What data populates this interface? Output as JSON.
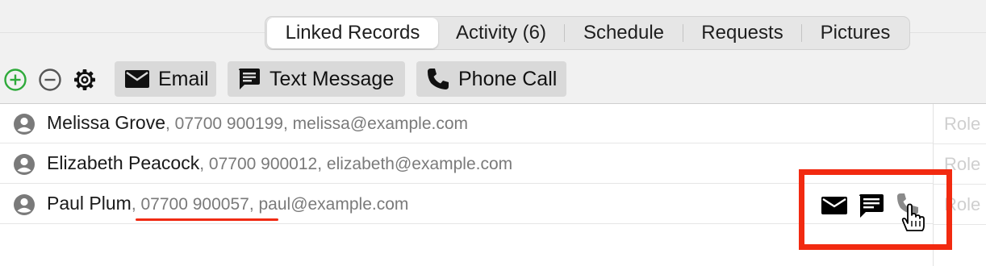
{
  "tabs": [
    {
      "label": "Linked Records",
      "active": true
    },
    {
      "label": "Activity (6)",
      "active": false
    },
    {
      "label": "Schedule",
      "active": false
    },
    {
      "label": "Requests",
      "active": false
    },
    {
      "label": "Pictures",
      "active": false
    }
  ],
  "toolbar": {
    "add_icon": "plus-circle-icon",
    "remove_icon": "minus-circle-icon",
    "settings_icon": "gear-icon",
    "email_label": "Email",
    "text_label": "Text Message",
    "call_label": "Phone Call"
  },
  "contacts": [
    {
      "name": "Melissa Grove",
      "phone": "07700 900199",
      "email": "melissa@example.com"
    },
    {
      "name": "Elizabeth Peacock",
      "phone": "07700 900012",
      "email": "elizabeth@example.com"
    },
    {
      "name": "Paul Plum",
      "phone": "07700 900057",
      "email": "paul@example.com"
    }
  ],
  "role_column": {
    "label": "Role"
  },
  "row_actions": [
    "envelope-icon",
    "message-icon",
    "phone-icon"
  ],
  "colors": {
    "accent_add": "#2eaa3a",
    "highlight": "#f22a10"
  }
}
